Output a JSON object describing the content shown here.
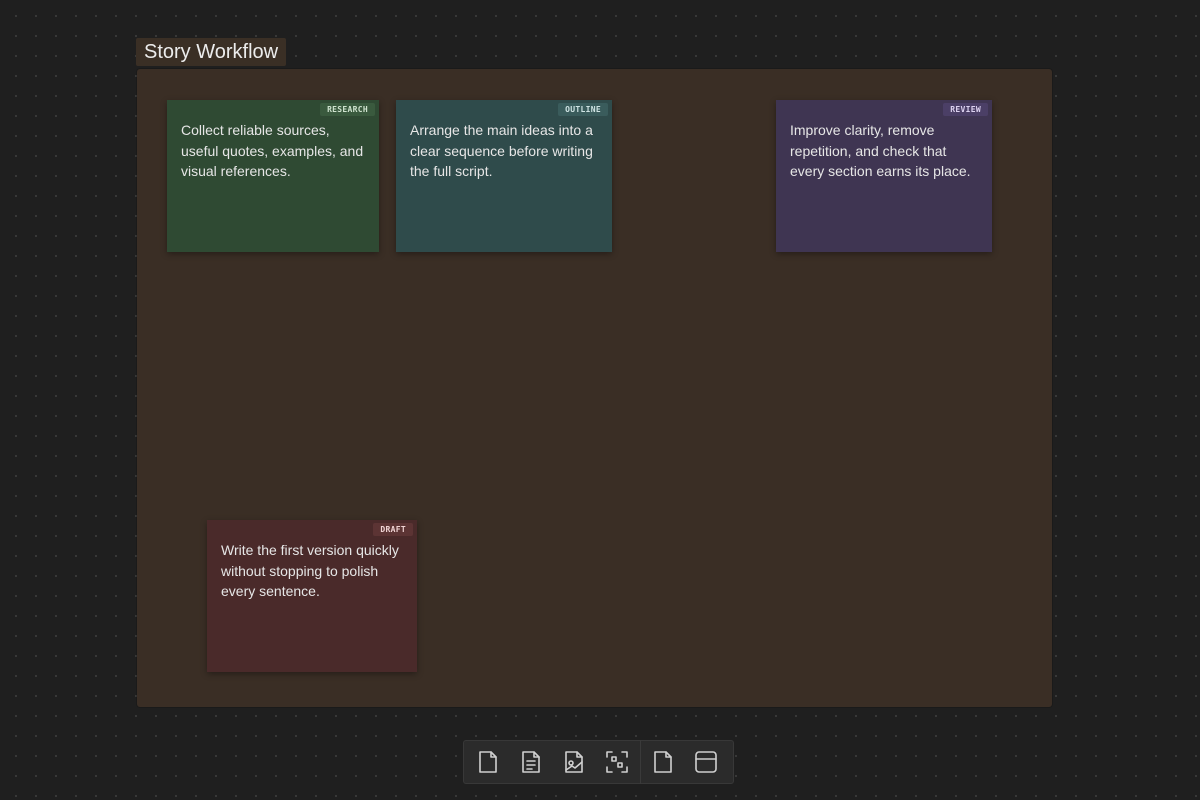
{
  "group": {
    "label": "Story Workflow"
  },
  "cards": {
    "research": {
      "tag": "RESEARCH",
      "text": "Collect reliable sources, useful quotes, examples, and visual references.",
      "color": "#2f4a33"
    },
    "outline": {
      "tag": "OUTLINE",
      "text": "Arrange the main ideas into a clear sequence before writing the full script.",
      "color": "#2f4b4b"
    },
    "review": {
      "tag": "REVIEW",
      "text": "Improve clarity, remove repetition, and check that every section earns its place.",
      "color": "#3f3552"
    },
    "draft": {
      "tag": "DRAFT",
      "text": "Write the first version quickly without stopping to polish every sentence.",
      "color": "#4a2a2a"
    }
  },
  "toolbar": {
    "tools": [
      {
        "icon": "new-note-icon"
      },
      {
        "icon": "note-from-file-icon"
      },
      {
        "icon": "media-icon"
      },
      {
        "icon": "group-icon"
      },
      {
        "icon": "blank-card-icon"
      },
      {
        "icon": "layout-icon"
      }
    ]
  },
  "colors": {
    "canvas_bg": "#1f1f1f",
    "group_bg": "#3a2e25"
  }
}
